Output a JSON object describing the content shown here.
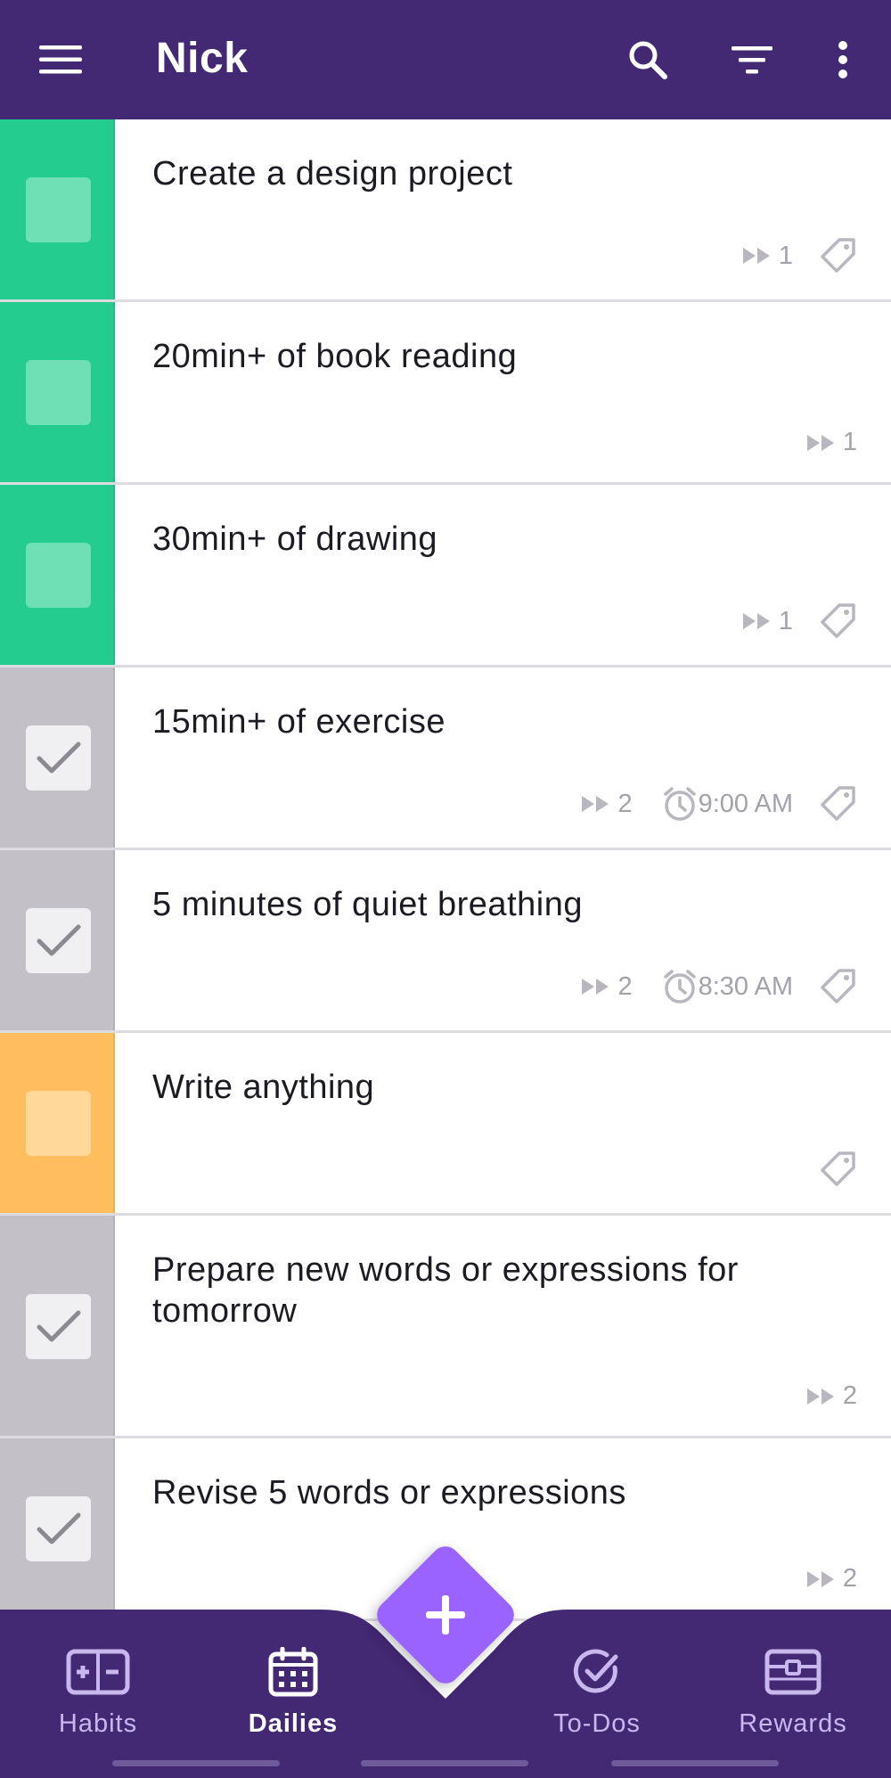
{
  "appbar": {
    "title": "Nick",
    "icons": [
      "menu-icon",
      "search-icon",
      "filter-icon",
      "more-vert-icon"
    ]
  },
  "colors": {
    "header": "#432874",
    "green": "#24cc8f",
    "green_box": "#6fe0b6",
    "grey": "#c3c0c7",
    "grey_box": "#f0f0f2",
    "yellow": "#ffbe5d",
    "yellow_box": "#ffd89a",
    "fab": "#9a62ff"
  },
  "tasks": [
    {
      "name": "Create a design project",
      "color": "green",
      "checked": false,
      "streak": "1",
      "reminder": "",
      "tag": true
    },
    {
      "name": "20min+ of book reading",
      "color": "green",
      "checked": false,
      "streak": "1",
      "reminder": "",
      "tag": false
    },
    {
      "name": "30min+ of drawing",
      "color": "green",
      "checked": false,
      "streak": "1",
      "reminder": "",
      "tag": true
    },
    {
      "name": "15min+ of exercise",
      "color": "grey",
      "checked": true,
      "streak": "2",
      "reminder": "9:00 AM",
      "tag": true
    },
    {
      "name": "5 minutes of quiet breathing",
      "color": "grey",
      "checked": true,
      "streak": "2",
      "reminder": "8:30 AM",
      "tag": true
    },
    {
      "name": "Write anything",
      "color": "yellow",
      "checked": false,
      "streak": "",
      "reminder": "",
      "tag": true
    },
    {
      "name": "Prepare new words or expressions for tomorrow",
      "color": "grey",
      "checked": true,
      "streak": "2",
      "reminder": "",
      "tag": false
    },
    {
      "name": "Revise 5 words or expressions",
      "color": "grey",
      "checked": true,
      "streak": "2",
      "reminder": "",
      "tag": false
    }
  ],
  "nav": {
    "items": [
      {
        "label": "Habits",
        "icon": "habits-icon",
        "active": false
      },
      {
        "label": "Dailies",
        "icon": "calendar-icon",
        "active": true
      },
      {
        "label": "To-Dos",
        "icon": "check-circle-icon",
        "active": false
      },
      {
        "label": "Rewards",
        "icon": "treasure-chest-icon",
        "active": false
      }
    ],
    "fab_icon": "plus-icon"
  }
}
